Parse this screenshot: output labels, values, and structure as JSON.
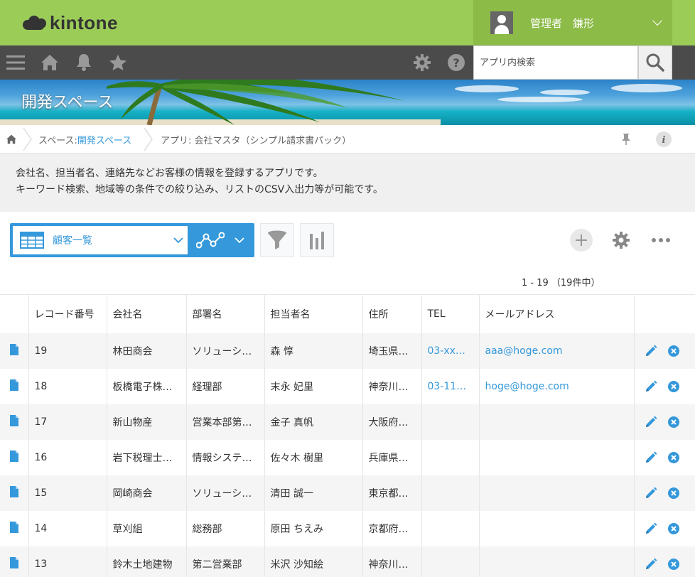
{
  "header": {
    "logo_text": "kintone",
    "user_name": "管理者　鎌形",
    "search_placeholder": "アプリ内検索"
  },
  "banner": {
    "title": "開発スペース"
  },
  "breadcrumb": {
    "space_prefix": "スペース: ",
    "space_name": "開発スペース",
    "app_label": "アプリ: 会社マスタ（シンプル請求書パック）"
  },
  "description": {
    "line1": "会社名、担当者名、連絡先などお客様の情報を登録するアプリです。",
    "line2": "キーワード検索、地域等の条件での絞り込み、リストのCSV入出力等が可能です。"
  },
  "toolbar": {
    "view_name": "顧客一覧"
  },
  "pager": {
    "text": "1 - 19 （19件中）"
  },
  "table": {
    "headers": [
      "",
      "レコード番号",
      "会社名",
      "部署名",
      "担当者名",
      "住所",
      "TEL",
      "メールアドレス",
      ""
    ],
    "rows": [
      {
        "id": "19",
        "company": "林田商会",
        "dept": "ソリューシ…",
        "person": "森 惇",
        "address": "埼玉県…",
        "tel": "03-xx…",
        "email": "aaa@hoge.com"
      },
      {
        "id": "18",
        "company": "板橋電子株…",
        "dept": "経理部",
        "person": "末永 妃里",
        "address": "神奈川…",
        "tel": "03-11…",
        "email": "hoge@hoge.com"
      },
      {
        "id": "17",
        "company": "新山物産",
        "dept": "営業本部第…",
        "person": "金子 真帆",
        "address": "大阪府…",
        "tel": "",
        "email": ""
      },
      {
        "id": "16",
        "company": "岩下税理士…",
        "dept": "情報システ…",
        "person": "佐々木 樹里",
        "address": "兵庫県…",
        "tel": "",
        "email": ""
      },
      {
        "id": "15",
        "company": "岡崎商会",
        "dept": "ソリューシ…",
        "person": "清田 誠一",
        "address": "東京都…",
        "tel": "",
        "email": ""
      },
      {
        "id": "14",
        "company": "草刈組",
        "dept": "総務部",
        "person": "原田 ちえみ",
        "address": "京都府…",
        "tel": "",
        "email": ""
      },
      {
        "id": "13",
        "company": "鈴木土地建物",
        "dept": "第二営業部",
        "person": "米沢 沙知絵",
        "address": "神奈川…",
        "tel": "",
        "email": ""
      }
    ]
  },
  "colors": {
    "header_green": "#9ccc58",
    "nav_dark": "#4b4b4b",
    "accent_blue": "#3498db"
  }
}
